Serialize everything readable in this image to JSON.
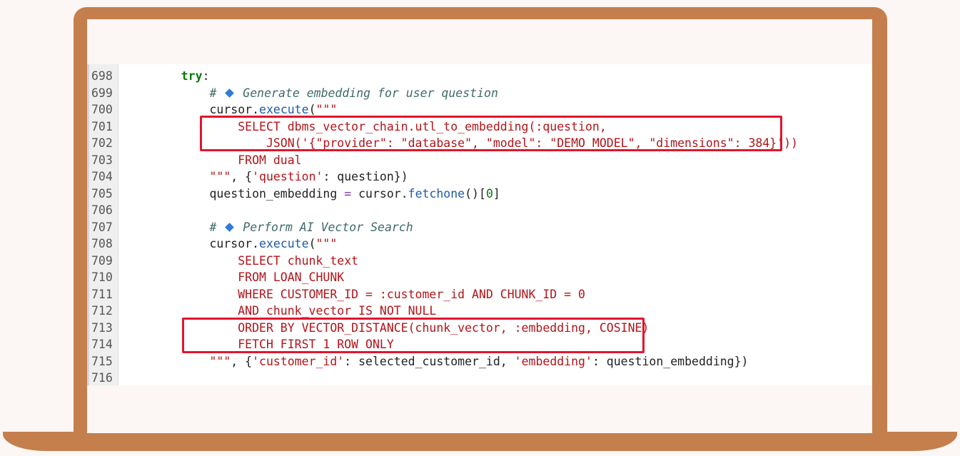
{
  "lines": [
    {
      "n": "698",
      "parts": [
        [
          "",
          "    "
        ],
        [
          "kw",
          "try"
        ],
        [
          "",
          ":"
        ]
      ]
    },
    {
      "n": "699",
      "parts": [
        [
          "",
          "        "
        ],
        [
          "cm",
          "# "
        ],
        [
          "icon",
          "diamond"
        ],
        [
          "cm",
          " Generate embedding for user question"
        ]
      ]
    },
    {
      "n": "700",
      "parts": [
        [
          "",
          "        cursor."
        ],
        [
          "fn",
          "execute"
        ],
        [
          "",
          "("
        ],
        [
          "st",
          "\"\"\""
        ]
      ]
    },
    {
      "n": "701",
      "parts": [
        [
          "st",
          "            SELECT dbms_vector_chain.utl_to_embedding(:question,"
        ]
      ]
    },
    {
      "n": "702",
      "parts": [
        [
          "st",
          "                JSON('{\"provider\": \"database\", \"model\": \"DEMO_MODEL\", \"dimensions\": 384}'))"
        ]
      ]
    },
    {
      "n": "703",
      "parts": [
        [
          "st",
          "            FROM dual"
        ]
      ]
    },
    {
      "n": "704",
      "parts": [
        [
          "st",
          "        \"\"\""
        ],
        [
          "",
          ", {"
        ],
        [
          "st",
          "'question'"
        ],
        [
          "",
          ": question})"
        ]
      ]
    },
    {
      "n": "705",
      "parts": [
        [
          "",
          "        question_embedding "
        ],
        [
          "op",
          "="
        ],
        [
          "",
          " cursor."
        ],
        [
          "fn",
          "fetchone"
        ],
        [
          "",
          "()["
        ],
        [
          "num",
          "0"
        ],
        [
          "",
          "]"
        ]
      ]
    },
    {
      "n": "706",
      "parts": [
        [
          "",
          ""
        ]
      ]
    },
    {
      "n": "707",
      "parts": [
        [
          "",
          "        "
        ],
        [
          "cm",
          "# "
        ],
        [
          "icon",
          "diamond"
        ],
        [
          "cm",
          " Perform AI Vector Search"
        ]
      ]
    },
    {
      "n": "708",
      "parts": [
        [
          "",
          "        cursor."
        ],
        [
          "fn",
          "execute"
        ],
        [
          "",
          "("
        ],
        [
          "st",
          "\"\"\""
        ]
      ]
    },
    {
      "n": "709",
      "parts": [
        [
          "st",
          "            SELECT chunk_text"
        ]
      ]
    },
    {
      "n": "710",
      "parts": [
        [
          "st",
          "            FROM LOAN_CHUNK"
        ]
      ]
    },
    {
      "n": "711",
      "parts": [
        [
          "st",
          "            WHERE CUSTOMER_ID = :customer_id AND CHUNK_ID = 0"
        ]
      ]
    },
    {
      "n": "712",
      "parts": [
        [
          "st",
          "            AND chunk_vector IS NOT NULL"
        ]
      ]
    },
    {
      "n": "713",
      "parts": [
        [
          "st",
          "            ORDER BY VECTOR_DISTANCE(chunk_vector, :embedding, COSINE)"
        ]
      ]
    },
    {
      "n": "714",
      "parts": [
        [
          "st",
          "            FETCH FIRST 1 ROW ONLY"
        ]
      ]
    },
    {
      "n": "715",
      "parts": [
        [
          "st",
          "        \"\"\""
        ],
        [
          "",
          ", {"
        ],
        [
          "st",
          "'customer_id'"
        ],
        [
          "",
          ": selected_customer_id, "
        ],
        [
          "st",
          "'embedding'"
        ],
        [
          "",
          ": question_embedding})"
        ]
      ]
    },
    {
      "n": "716",
      "parts": [
        [
          "",
          ""
        ]
      ]
    }
  ],
  "colors": {
    "frame": "#c47f4d",
    "highlight": "#e0162e",
    "keyword": "#0a7a0a",
    "string": "#b3141a",
    "function": "#1e5aa8",
    "comment": "#3f6a6a",
    "icon": "#2f7bd6"
  },
  "icons": {
    "comment_marker": "blue-diamond-icon"
  }
}
